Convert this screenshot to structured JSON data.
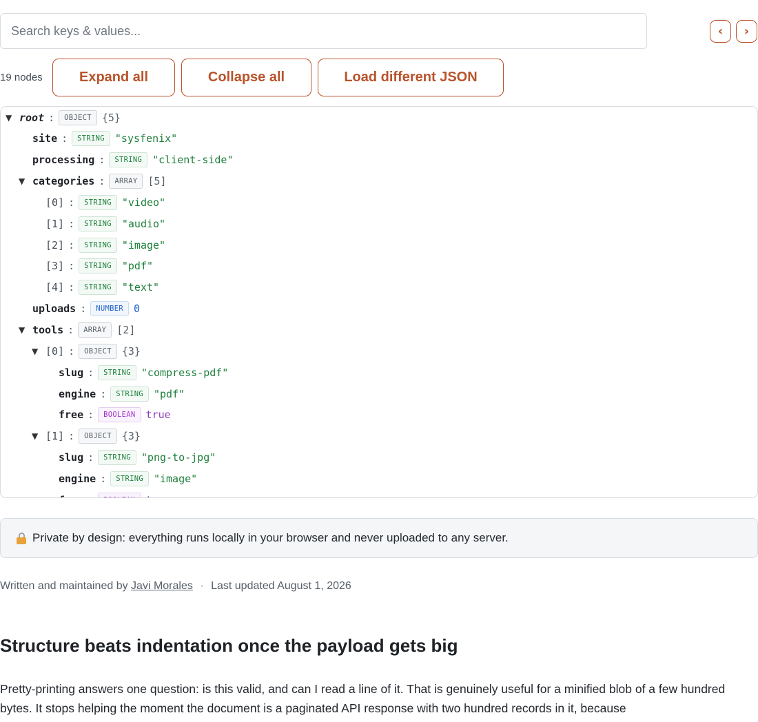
{
  "search": {
    "placeholder": "Search keys & values..."
  },
  "nav": {
    "prev": "‹",
    "next": "›"
  },
  "toolbar": {
    "node_count": "19 nodes",
    "expand_all": "Expand all",
    "collapse_all": "Collapse all",
    "load_json": "Load different JSON"
  },
  "tree": [
    {
      "depth": 0,
      "toggle": "▼",
      "key": "root",
      "key_style": "root",
      "type": "OBJECT",
      "value": "{5}",
      "vtype": "meta"
    },
    {
      "depth": 1,
      "toggle": "",
      "key": "site",
      "key_style": "key",
      "type": "STRING",
      "value": "\"sysfenix\"",
      "vtype": "string"
    },
    {
      "depth": 1,
      "toggle": "",
      "key": "processing",
      "key_style": "key",
      "type": "STRING",
      "value": "\"client-side\"",
      "vtype": "string"
    },
    {
      "depth": 1,
      "toggle": "▼",
      "key": "categories",
      "key_style": "key",
      "type": "ARRAY",
      "value": "[5]",
      "vtype": "meta"
    },
    {
      "depth": 2,
      "toggle": "",
      "key": "[0]",
      "key_style": "idx",
      "type": "STRING",
      "value": "\"video\"",
      "vtype": "string"
    },
    {
      "depth": 2,
      "toggle": "",
      "key": "[1]",
      "key_style": "idx",
      "type": "STRING",
      "value": "\"audio\"",
      "vtype": "string"
    },
    {
      "depth": 2,
      "toggle": "",
      "key": "[2]",
      "key_style": "idx",
      "type": "STRING",
      "value": "\"image\"",
      "vtype": "string"
    },
    {
      "depth": 2,
      "toggle": "",
      "key": "[3]",
      "key_style": "idx",
      "type": "STRING",
      "value": "\"pdf\"",
      "vtype": "string"
    },
    {
      "depth": 2,
      "toggle": "",
      "key": "[4]",
      "key_style": "idx",
      "type": "STRING",
      "value": "\"text\"",
      "vtype": "string"
    },
    {
      "depth": 1,
      "toggle": "",
      "key": "uploads",
      "key_style": "key",
      "type": "NUMBER",
      "value": "0",
      "vtype": "number"
    },
    {
      "depth": 1,
      "toggle": "▼",
      "key": "tools",
      "key_style": "key",
      "type": "ARRAY",
      "value": "[2]",
      "vtype": "meta"
    },
    {
      "depth": 2,
      "toggle": "▼",
      "key": "[0]",
      "key_style": "idx",
      "type": "OBJECT",
      "value": "{3}",
      "vtype": "meta"
    },
    {
      "depth": 3,
      "toggle": "",
      "key": "slug",
      "key_style": "key",
      "type": "STRING",
      "value": "\"compress-pdf\"",
      "vtype": "string"
    },
    {
      "depth": 3,
      "toggle": "",
      "key": "engine",
      "key_style": "key",
      "type": "STRING",
      "value": "\"pdf\"",
      "vtype": "string"
    },
    {
      "depth": 3,
      "toggle": "",
      "key": "free",
      "key_style": "key",
      "type": "BOOLEAN",
      "value": "true",
      "vtype": "boolean"
    },
    {
      "depth": 2,
      "toggle": "▼",
      "key": "[1]",
      "key_style": "idx",
      "type": "OBJECT",
      "value": "{3}",
      "vtype": "meta"
    },
    {
      "depth": 3,
      "toggle": "",
      "key": "slug",
      "key_style": "key",
      "type": "STRING",
      "value": "\"png-to-jpg\"",
      "vtype": "string"
    },
    {
      "depth": 3,
      "toggle": "",
      "key": "engine",
      "key_style": "key",
      "type": "STRING",
      "value": "\"image\"",
      "vtype": "string"
    },
    {
      "depth": 3,
      "toggle": "",
      "key": "free",
      "key_style": "key",
      "type": "BOOLEAN",
      "value": "true",
      "vtype": "boolean"
    }
  ],
  "privacy": {
    "icon": "lock-icon",
    "text": "Private by design: everything runs locally in your browser and never uploaded to any server."
  },
  "author": {
    "prefix": "Written and maintained by",
    "name": "Javi Morales",
    "separator": "·",
    "updated": "Last updated August 1, 2026"
  },
  "article": {
    "title": "Structure beats indentation once the payload gets big",
    "body": "Pretty-printing answers one question: is this valid, and can I read a line of it. That is genuinely useful for a minified blob of a few hundred bytes. It stops helping the moment the document is a paginated API response with two hundred records in it, because"
  },
  "colors": {
    "accent": "#b9532b",
    "string": "#1d7f3a",
    "number": "#1e64c8",
    "boolean": "#8a3fb8",
    "border": "#d8dbe0"
  }
}
